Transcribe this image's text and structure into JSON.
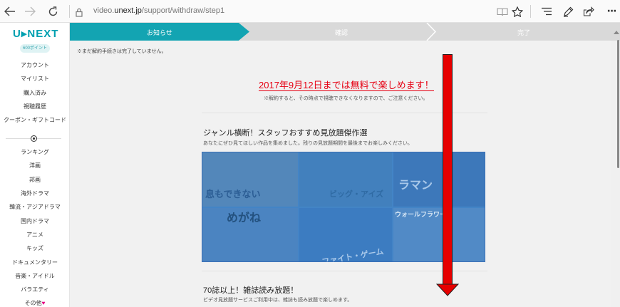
{
  "browser": {
    "url_prefix": "video.",
    "url_domain": "unext.jp",
    "url_path": "/support/withdraw/step1",
    "icons": [
      "back-icon",
      "forward-icon",
      "refresh-icon",
      "lock-icon",
      "reading-view-icon",
      "favorite-star-icon",
      "hub-icon",
      "notes-pen-icon",
      "share-icon",
      "more-icon"
    ],
    "more_label": "···"
  },
  "sidebar": {
    "logo": "U▸NEXT",
    "points_badge": "600ポイント",
    "account_items": [
      "アカウント",
      "マイリスト",
      "購入済み",
      "視聴履歴",
      "クーポン・ギフトコード"
    ],
    "genre_items": [
      "ランキング",
      "洋画",
      "邦画",
      "海外ドラマ",
      "韓流・アジアドラマ",
      "国内ドラマ",
      "アニメ",
      "キッズ",
      "ドキュメンタリー",
      "音楽・アイドル",
      "バラエティ"
    ],
    "other_label": "その他",
    "other_heart": "♥"
  },
  "steps": [
    {
      "label": "お知らせ",
      "active": true
    },
    {
      "label": "確認",
      "active": false
    },
    {
      "label": "完了",
      "active": false
    }
  ],
  "content": {
    "incomplete_notice": "※まだ解約手続きは完了していません。",
    "free_until": "2017年9月12日までは無料で楽しめます！",
    "free_note": "※解約すると、その時点で視聴できなくなりますので、ご注意ください。",
    "section1": {
      "title": "ジャンル横断！スタッフおすすめ見放題傑作選",
      "desc": "あなたにぜひ見てほしい作品を集めました。残りの見放題期間を最後までお楽しみください。"
    },
    "mosaic_labels": [
      "息もできない",
      "ビッグ・アイズ",
      "ラマン",
      "めがね",
      "ファイト・ゲーム",
      "ウォールフラワー"
    ],
    "section2": {
      "title": "70誌以上！雑誌読み放題！",
      "desc": "ビデオ見放題サービスご利用中は、雑誌も読み放題で楽しめます。"
    }
  },
  "colors": {
    "brand": "#00a0b0",
    "step_active": "#13a4b2",
    "alert_red": "#e60012",
    "arrow_red": "#e60000"
  }
}
